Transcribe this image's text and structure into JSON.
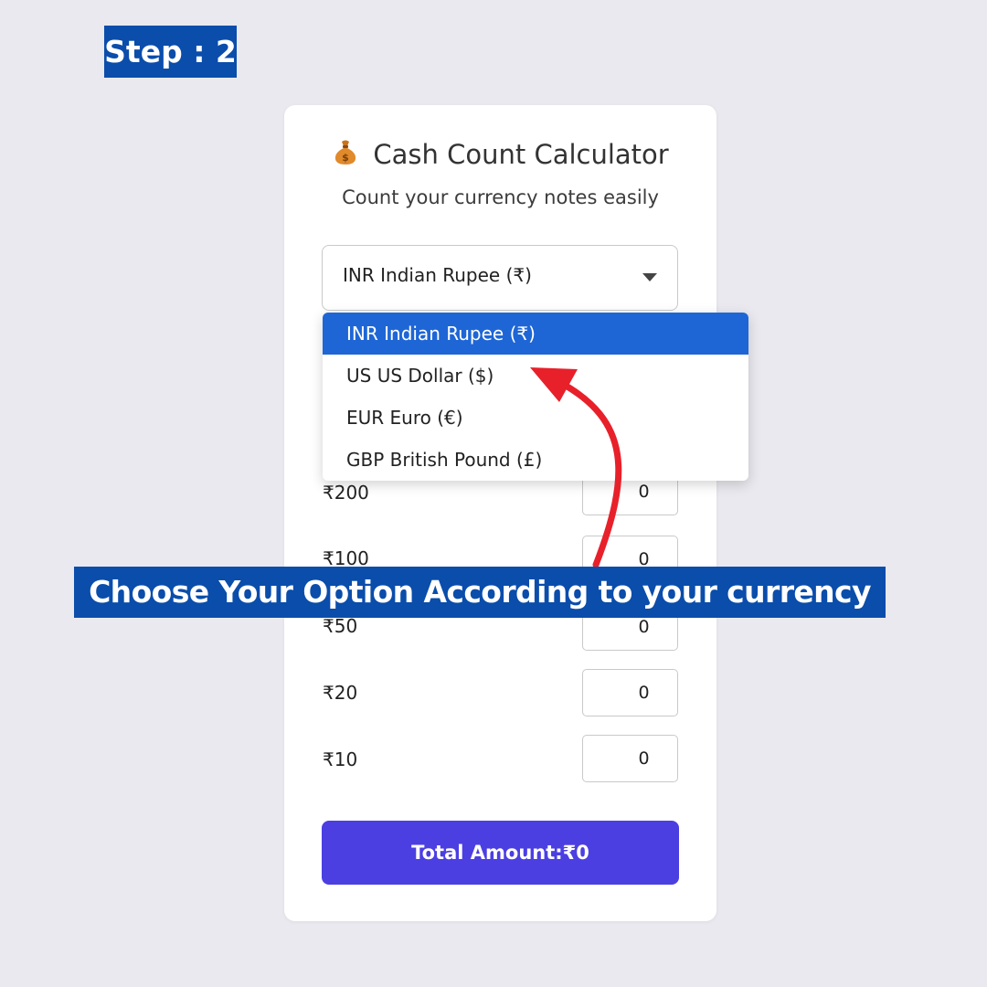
{
  "step_badge": "Step : 2",
  "card": {
    "title": "Cash Count Calculator",
    "title_icon": "money-bag-icon",
    "subtitle": "Count your currency notes easily"
  },
  "currency_select": {
    "selected": "INR Indian Rupee (₹)",
    "options": [
      "INR Indian Rupee (₹)",
      "US US Dollar ($)",
      "EUR Euro (€)",
      "GBP British Pound (£)"
    ]
  },
  "denominations": [
    {
      "label": "₹200",
      "value": "0"
    },
    {
      "label": "₹100",
      "value": "0"
    },
    {
      "label": "₹50",
      "value": "0"
    },
    {
      "label": "₹20",
      "value": "0"
    },
    {
      "label": "₹10",
      "value": "0"
    }
  ],
  "total_button": "Total Amount:₹0",
  "banner": "Choose Your Option According to your currency",
  "colors": {
    "badge_bg": "#0a4dab",
    "selected_option": "#1e66d6",
    "total_button": "#4b3fe2",
    "arrow": "#e8202a",
    "page_bg": "#e9e9ef"
  }
}
